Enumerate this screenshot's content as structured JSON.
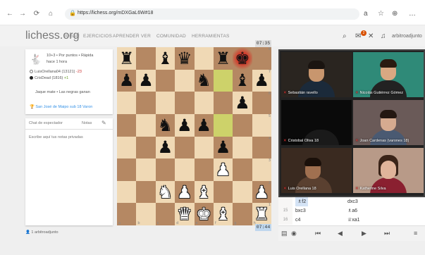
{
  "browser": {
    "url": "https://lichess.org/mDXGaL6W#18",
    "back": "←",
    "forward": "→",
    "reload": "⟳",
    "home": "⌂",
    "lock": "🔒",
    "icons": [
      "a",
      "☆",
      "⊕",
      "…"
    ]
  },
  "header": {
    "logo": "lichess.org",
    "nav": [
      "JUGAR",
      "EJERCICIOS",
      "APRENDER",
      "VER",
      "COMUNIDAD",
      "HERRAMIENTAS"
    ],
    "notif_count": "2",
    "user": "arbitroadjunto",
    "search_icon": "⌕",
    "notif_icon": "✉",
    "tools_icon": "✕",
    "bell_icon": "♫"
  },
  "game_info": {
    "variant": "10+3 • Por puntos • Rápida",
    "time_ago": "hace 1 hora",
    "white_player": "LuisOrellana04 (13121)",
    "white_diff": "-23",
    "black_player": "CrisDead (1816)",
    "black_diff": "+1",
    "result": "Jaque mate • Las negras ganan",
    "tournament": "San José de Maipo sub 18 Varon"
  },
  "chat": {
    "tab_chat": "Chat de espectador",
    "tab_notes": "Notas",
    "notes_placeholder": "Escribe aquí tus notas privadas",
    "toggle_icon": "✎"
  },
  "spectators": "1 arbitroadjunto",
  "clocks": {
    "top": "07:35",
    "bottom": "07:44"
  },
  "board": {
    "rows": [
      [
        "bR",
        "",
        "bB",
        "bQ",
        "",
        "bR",
        "bK",
        ""
      ],
      [
        "bP",
        "bP",
        "",
        "",
        "bN",
        "",
        "bB",
        "bP"
      ],
      [
        "",
        "",
        "",
        "",
        "",
        "",
        "bP",
        ""
      ],
      [
        "",
        "",
        "bN",
        "bP",
        "bP",
        "",
        "",
        ""
      ],
      [
        "",
        "",
        "bP",
        "",
        "",
        "bP",
        "",
        ""
      ],
      [
        "",
        "",
        "",
        "",
        "",
        "wP",
        "",
        ""
      ],
      [
        "",
        "",
        "wN",
        "wP",
        "wB",
        "",
        "",
        "wP"
      ],
      [
        "wP",
        "wP",
        "",
        "",
        "wN",
        "",
        "wP",
        ""
      ]
    ],
    "extra_rows": [
      [
        "",
        "",
        "",
        "wQ",
        "wK",
        "wB",
        "",
        "wR"
      ]
    ],
    "rank_labels": [
      "8",
      "7",
      "6",
      "5",
      "4",
      "3",
      "2",
      "1"
    ],
    "file_labels": [
      "a",
      "b",
      "c",
      "d",
      "e",
      "f",
      "g",
      "h"
    ]
  },
  "participants": [
    {
      "name": "Sebastián ravello"
    },
    {
      "name": "Nicolás Gutiérrez Gómez"
    },
    {
      "name": "Cristobal Oliva 18"
    },
    {
      "name": "Joan Cardenas (varones 18)"
    },
    {
      "name": "Luis Orellana 18"
    },
    {
      "name": "Katherine Silva"
    }
  ],
  "moves": [
    {
      "num": "",
      "white": "♗f2",
      "black": "dxc3"
    },
    {
      "num": "15",
      "white": "bxc3",
      "black": "♗a6"
    },
    {
      "num": "16",
      "white": "c4",
      "black": "♕xa1"
    }
  ],
  "controls": [
    "▤",
    "◉",
    "⏮",
    "◀",
    "▶",
    "⏭",
    "≡"
  ]
}
